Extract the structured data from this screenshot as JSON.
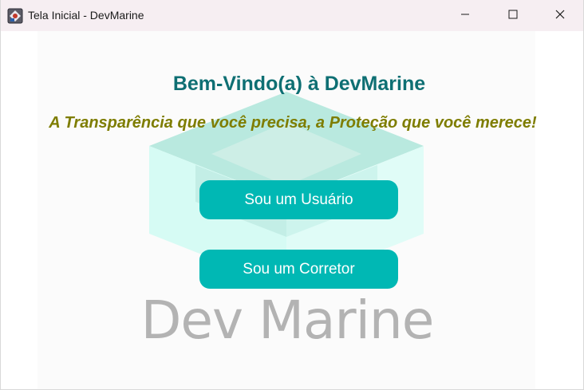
{
  "window": {
    "title": "Tela Inicial - DevMarine",
    "icon": "java-app-icon",
    "controls": [
      "minimize-icon",
      "maximize-icon",
      "close-icon"
    ]
  },
  "main": {
    "welcome": "Bem-Vindo(a) à DevMarine",
    "slogan": "A Transparência que você precisa, a Proteção que você merece!",
    "buttons": {
      "user_label": "Sou um Usuário",
      "broker_label": "Sou um Corretor"
    },
    "logo_text": "Dev Marine"
  },
  "colors": {
    "title_bar": "#f6eef2",
    "welcome_text": "#0e6f73",
    "slogan_text": "#7e7d00",
    "button_bg": "#00b8b4",
    "button_text": "#ffffff",
    "logo_text": "#b3b3b3"
  }
}
